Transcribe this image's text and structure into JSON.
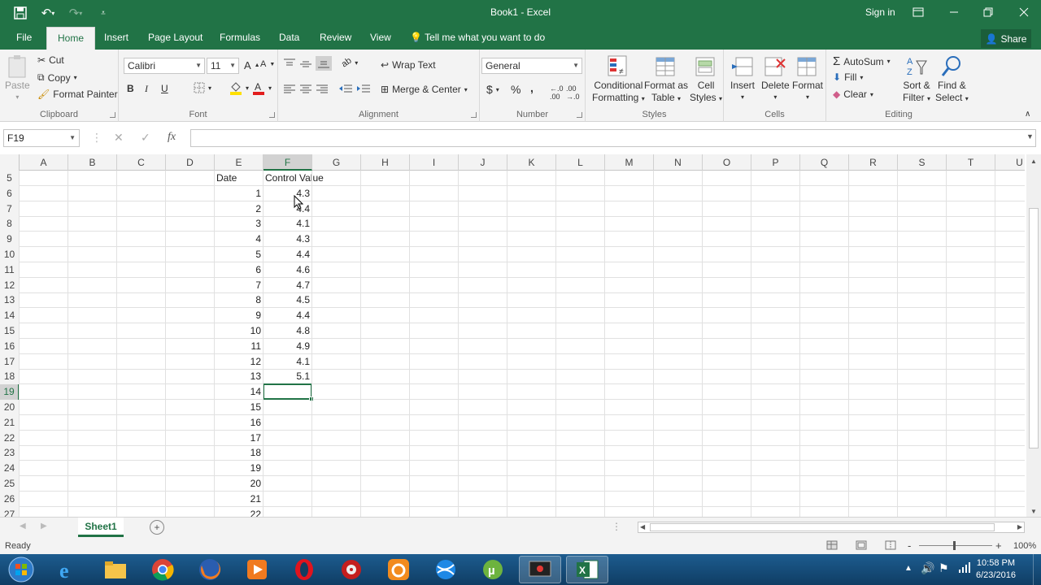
{
  "window": {
    "title": "Book1 - Excel",
    "sign_in": "Sign in"
  },
  "ribbon_tabs": [
    "File",
    "Home",
    "Insert",
    "Page Layout",
    "Formulas",
    "Data",
    "Review",
    "View"
  ],
  "tell_me": "Tell me what you want to do",
  "share": "Share",
  "clipboard": {
    "paste": "Paste",
    "cut": "Cut",
    "copy": "Copy",
    "format_painter": "Format Painter",
    "label": "Clipboard"
  },
  "font": {
    "name": "Calibri",
    "size": "11",
    "bold": "B",
    "italic": "I",
    "underline": "U",
    "label": "Font"
  },
  "alignment": {
    "wrap_text": "Wrap Text",
    "merge_center": "Merge & Center",
    "label": "Alignment"
  },
  "number": {
    "format": "General",
    "currency": "$",
    "percent": "%",
    "comma": ",",
    "label": "Number"
  },
  "styles": {
    "conditional": "Conditional",
    "formatting": "Formatting",
    "format_as": "Format as",
    "table": "Table",
    "cell": "Cell",
    "cell_styles": "Styles",
    "label": "Styles"
  },
  "cells": {
    "insert": "Insert",
    "delete": "Delete",
    "format": "Format",
    "label": "Cells"
  },
  "editing": {
    "autosum": "AutoSum",
    "fill": "Fill",
    "clear": "Clear",
    "sort_filter_1": "Sort &",
    "sort_filter_2": "Filter",
    "find_select_1": "Find &",
    "find_select_2": "Select",
    "label": "Editing"
  },
  "formula_bar": {
    "name_box": "F19",
    "fx": "fx",
    "value": ""
  },
  "columns": [
    "A",
    "B",
    "C",
    "D",
    "E",
    "F",
    "G",
    "H",
    "I",
    "J",
    "K",
    "L",
    "M",
    "N",
    "O",
    "P",
    "Q",
    "R",
    "S",
    "T",
    "U"
  ],
  "selected_column": "F",
  "selected_row": "19",
  "rows": [
    {
      "num": "5",
      "e": "Date",
      "f": "Control Value"
    },
    {
      "num": "6",
      "e": "1",
      "f": "4.3"
    },
    {
      "num": "7",
      "e": "2",
      "f": "4.4"
    },
    {
      "num": "8",
      "e": "3",
      "f": "4.1"
    },
    {
      "num": "9",
      "e": "4",
      "f": "4.3"
    },
    {
      "num": "10",
      "e": "5",
      "f": "4.4"
    },
    {
      "num": "11",
      "e": "6",
      "f": "4.6"
    },
    {
      "num": "12",
      "e": "7",
      "f": "4.7"
    },
    {
      "num": "13",
      "e": "8",
      "f": "4.5"
    },
    {
      "num": "14",
      "e": "9",
      "f": "4.4"
    },
    {
      "num": "15",
      "e": "10",
      "f": "4.8"
    },
    {
      "num": "16",
      "e": "11",
      "f": "4.9"
    },
    {
      "num": "17",
      "e": "12",
      "f": "4.1"
    },
    {
      "num": "18",
      "e": "13",
      "f": "5.1"
    },
    {
      "num": "19",
      "e": "14",
      "f": ""
    },
    {
      "num": "20",
      "e": "15",
      "f": ""
    },
    {
      "num": "21",
      "e": "16",
      "f": ""
    },
    {
      "num": "22",
      "e": "17",
      "f": ""
    },
    {
      "num": "23",
      "e": "18",
      "f": ""
    },
    {
      "num": "24",
      "e": "19",
      "f": ""
    },
    {
      "num": "25",
      "e": "20",
      "f": ""
    },
    {
      "num": "26",
      "e": "21",
      "f": ""
    },
    {
      "num": "27",
      "e": "22",
      "f": ""
    }
  ],
  "sheets": [
    "Sheet1"
  ],
  "status": {
    "ready": "Ready",
    "zoom": "100%",
    "minus": "-",
    "plus": "+"
  },
  "clock": {
    "time": "10:58 PM",
    "date": "6/23/2016"
  },
  "colors": {
    "excel_green": "#217346",
    "ribbon_bg": "#f3f3f3",
    "taskbar": "#1d5c8f"
  }
}
